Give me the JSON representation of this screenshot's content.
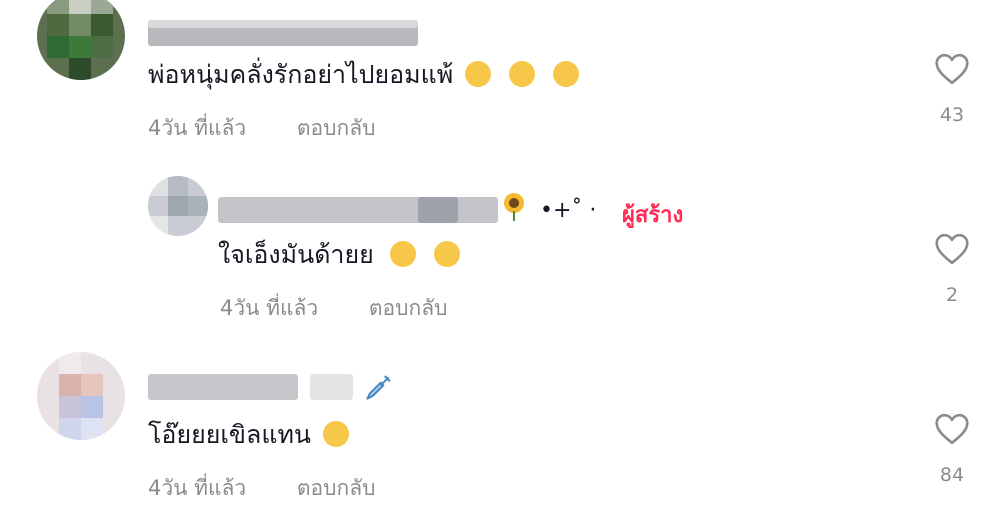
{
  "comments": [
    {
      "text": "พ่อหนุ่มคลั่งรักอย่าไปยอมแพ้",
      "time": "4วัน ที่แล้ว",
      "reply_label": "ตอบกลับ",
      "likes": "43",
      "emojis": [
        "flushed-face-icon",
        "flushed-face-icon",
        "flushed-face-icon"
      ]
    },
    {
      "text": "ใจเอ็งมันด้ายย",
      "time": "4วัน ที่แล้ว",
      "reply_label": "ตอบกลับ",
      "likes": "2",
      "name_suffix": "•+˚ ·",
      "creator_badge": "ผู้สร้าง",
      "emojis": [
        "laughing-tears-icon",
        "sweat-smile-icon"
      ]
    },
    {
      "text": "โอ๊ยยยเขิลแทน",
      "time": "4วัน ที่แล้ว",
      "reply_label": "ตอบกลับ",
      "likes": "84",
      "emojis": [
        "smiling-hearts-icon"
      ]
    }
  ],
  "colors": {
    "accent": "#fe2c55",
    "muted": "#8a8b91",
    "text": "#161823"
  }
}
